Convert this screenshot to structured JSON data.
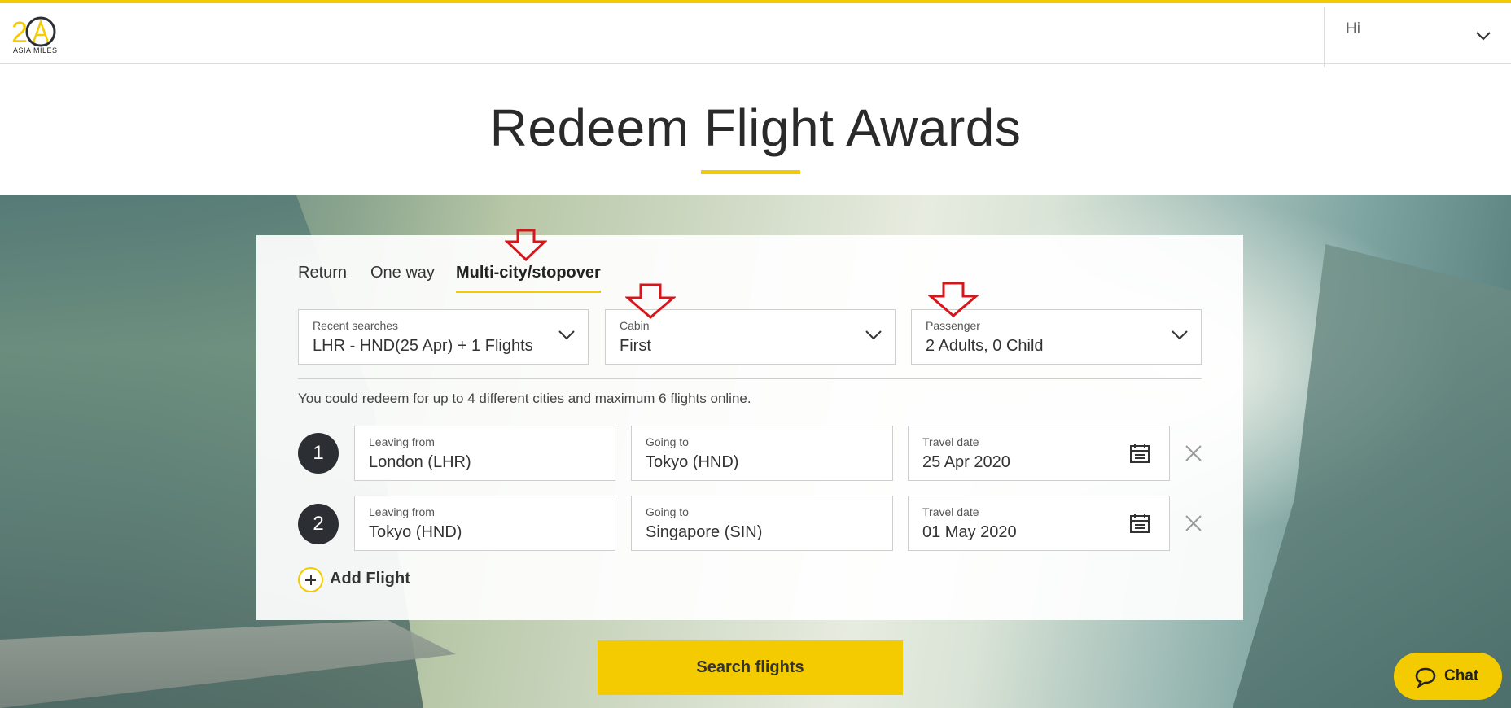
{
  "header": {
    "logo_number": "20",
    "logo_text": "ASIA MILES",
    "greeting": "Hi"
  },
  "page": {
    "title": "Redeem Flight Awards"
  },
  "tabs": [
    {
      "label": "Return",
      "active": false
    },
    {
      "label": "One way",
      "active": false
    },
    {
      "label": "Multi-city/stopover",
      "active": true
    }
  ],
  "options": {
    "recent": {
      "label": "Recent searches",
      "value": "LHR - HND(25 Apr) + 1 Flights"
    },
    "cabin": {
      "label": "Cabin",
      "value": "First"
    },
    "passenger": {
      "label": "Passenger",
      "value": "2 Adults, 0 Child"
    }
  },
  "info_text": "You could redeem for up to 4 different cities and maximum 6 flights online.",
  "flights": [
    {
      "number": "1",
      "from_label": "Leaving from",
      "from": "London (LHR)",
      "to_label": "Going to",
      "to": "Tokyo (HND)",
      "date_label": "Travel date",
      "date": "25 Apr 2020"
    },
    {
      "number": "2",
      "from_label": "Leaving from",
      "from": "Tokyo (HND)",
      "to_label": "Going to",
      "to": "Singapore (SIN)",
      "date_label": "Travel date",
      "date": "01 May 2020"
    }
  ],
  "add_flight_label": "Add Flight",
  "search_button": "Search flights",
  "chat_button": "Chat",
  "colors": {
    "accent": "#f4cb00",
    "annotation_arrow": "#d9151c",
    "number_badge": "#2b2f33"
  }
}
